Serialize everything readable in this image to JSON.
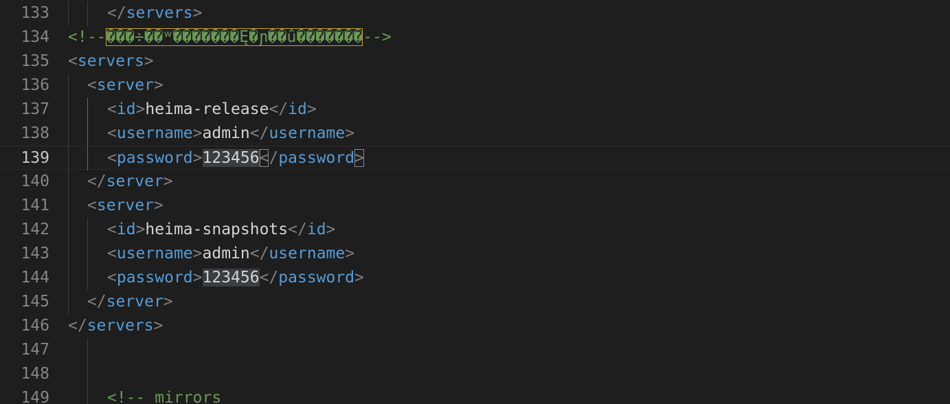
{
  "editor": {
    "language": "xml",
    "active_line": "139",
    "lines": [
      {
        "no": "133",
        "code": "</servers>"
      },
      {
        "no": "134",
        "comment_open": "<!--",
        "garbled": "���÷��ʷ�������Ę�ɲ��û�������",
        "comment_close": "-->"
      },
      {
        "no": "135",
        "code": "<servers>"
      },
      {
        "no": "136",
        "code": "<server>"
      },
      {
        "no": "137",
        "open_tag": "id",
        "value": "heima-release",
        "close_tag": "id"
      },
      {
        "no": "138",
        "open_tag": "username",
        "value": "admin",
        "close_tag": "username"
      },
      {
        "no": "139",
        "open_tag": "password",
        "value": "123456",
        "close_tag": "password"
      },
      {
        "no": "140",
        "code": "</server>"
      },
      {
        "no": "141",
        "code": "<server>"
      },
      {
        "no": "142",
        "open_tag": "id",
        "value": "heima-snapshots",
        "close_tag": "id"
      },
      {
        "no": "143",
        "open_tag": "username",
        "value": "admin",
        "close_tag": "username"
      },
      {
        "no": "144",
        "open_tag": "password",
        "value": "123456",
        "close_tag": "password"
      },
      {
        "no": "145",
        "code": "</server>"
      },
      {
        "no": "146",
        "code": "</servers>"
      },
      {
        "no": "147",
        "code": ""
      },
      {
        "no": "148",
        "code": ""
      },
      {
        "no": "149",
        "comment_text": "<!-- mirrors"
      }
    ]
  },
  "colors": {
    "background": "#1e1e1e",
    "tag": "#569cd6",
    "bracket": "#808080",
    "text": "#d4d4d4",
    "comment": "#6a9955",
    "line_number": "#858585",
    "active_line_number": "#c6c6c6"
  }
}
